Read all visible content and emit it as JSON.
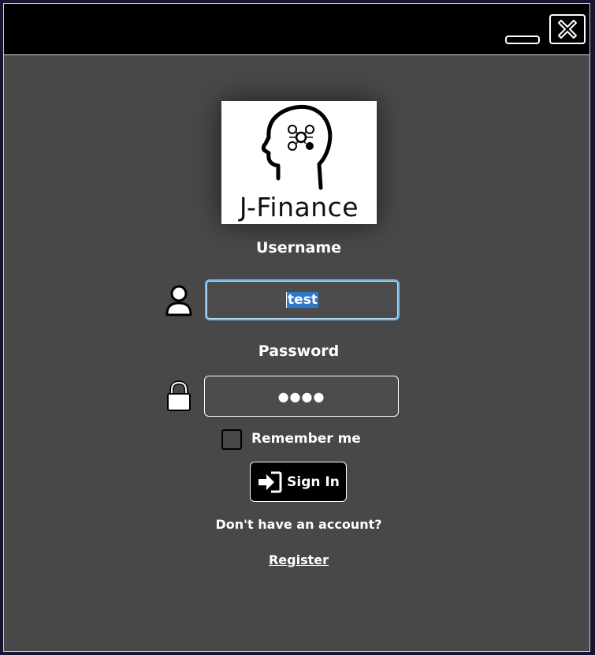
{
  "app": {
    "logo_text": "J-Finance"
  },
  "form": {
    "username_label": "Username",
    "username_value": "test",
    "password_label": "Password",
    "password_masked": "●●●●",
    "remember_label": "Remember me",
    "remember_checked": false,
    "signin_label": "Sign In",
    "no_account_text": "Don't have an account?",
    "register_link": "Register"
  },
  "colors": {
    "window_bg": "#484848",
    "titlebar_bg": "#000000",
    "focus_border": "#7ab8e6",
    "selection_bg": "#2f78c8"
  },
  "icons": {
    "minimize": "minimize-icon",
    "close": "close-icon",
    "user": "user-icon",
    "lock": "lock-icon",
    "signin": "sign-in-icon"
  }
}
